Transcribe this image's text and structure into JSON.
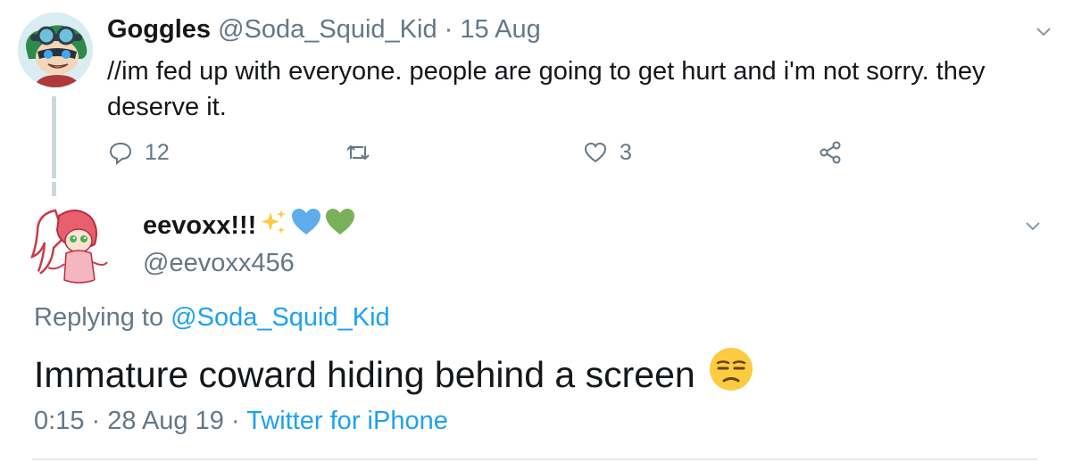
{
  "parent_tweet": {
    "display_name": "Goggles",
    "handle": "@Soda_Squid_Kid",
    "separator": "·",
    "date": "15 Aug",
    "text": "//im fed up with everyone.  people are going to get hurt and i'm not sorry. they deserve it.",
    "reply_count": "12",
    "retweet_count": "",
    "like_count": "3",
    "icons": [
      "reply-icon",
      "retweet-icon",
      "like-icon",
      "share-icon",
      "chevron-down-icon"
    ]
  },
  "reply_tweet": {
    "display_name": "eevoxx!!!",
    "name_emojis": [
      "sparkles-emoji",
      "blue-heart-emoji",
      "green-heart-emoji"
    ],
    "handle": "@eevoxx456",
    "replying_to_label": "Replying to",
    "replying_to_handle": "@Soda_Squid_Kid",
    "text": "Immature coward hiding behind a screen",
    "text_emoji": "unamused-face-emoji",
    "time": "0:15",
    "date": "28 Aug 19",
    "separator": "·",
    "client": "Twitter for iPhone"
  },
  "colors": {
    "primary_text": "#14171a",
    "secondary_text": "#657786",
    "link": "#1da1f2",
    "divider": "#e1e8ed",
    "thread_line": "#ccd6dd"
  }
}
